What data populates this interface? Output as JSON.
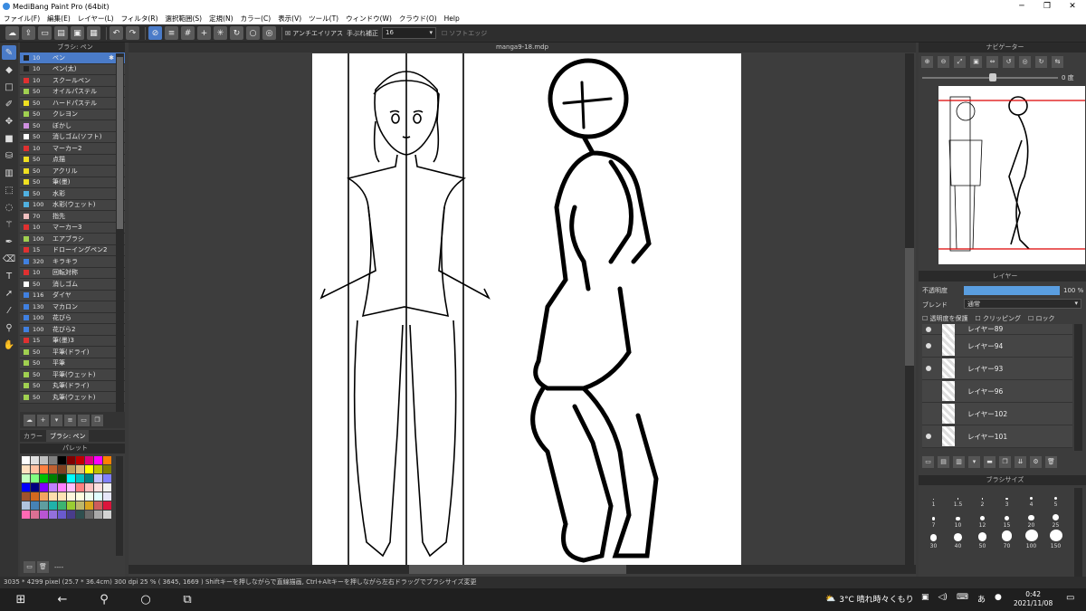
{
  "window": {
    "title": "MediBang Paint Pro (64bit)",
    "min": "─",
    "max": "❐",
    "close": "✕"
  },
  "menu": [
    "ファイル(F)",
    "編集(E)",
    "レイヤー(L)",
    "フィルタ(R)",
    "選択範囲(S)",
    "定規(N)",
    "カラー(C)",
    "表示(V)",
    "ツール(T)",
    "ウィンドウ(W)",
    "クラウド(O)",
    "Help"
  ],
  "toolbar": {
    "antialias": "アンチエイリアス",
    "stabilizer": "手ぶれ補正",
    "stabilizer_value": "16",
    "soft_edge": "ソフトエッジ"
  },
  "brush_panel": {
    "title": "ブラシ: ペン",
    "items": [
      {
        "size": "10",
        "name": "ペン",
        "color": "#222222",
        "selected": true
      },
      {
        "size": "10",
        "name": "ペン(太)",
        "color": "#222222"
      },
      {
        "size": "10",
        "name": "スクールペン",
        "color": "#e03030"
      },
      {
        "size": "50",
        "name": "オイルパステル",
        "color": "#a0d050"
      },
      {
        "size": "50",
        "name": "ハードパステル",
        "color": "#f0e020"
      },
      {
        "size": "50",
        "name": "クレヨン",
        "color": "#a0d050"
      },
      {
        "size": "50",
        "name": "ぼかし",
        "color": "#d090e0"
      },
      {
        "size": "50",
        "name": "消しゴム(ソフト)",
        "color": "#ffffff"
      },
      {
        "size": "10",
        "name": "マーカー2",
        "color": "#e03030"
      },
      {
        "size": "50",
        "name": "点描",
        "color": "#f0e020"
      },
      {
        "size": "50",
        "name": "アクリル",
        "color": "#f0e020"
      },
      {
        "size": "50",
        "name": "筆(墨)",
        "color": "#f0e020"
      },
      {
        "size": "50",
        "name": "水彩",
        "color": "#50b0e0"
      },
      {
        "size": "100",
        "name": "水彩(ウェット)",
        "color": "#50b0e0"
      },
      {
        "size": "70",
        "name": "指先",
        "color": "#f0c0c0"
      },
      {
        "size": "10",
        "name": "マーカー3",
        "color": "#e03030"
      },
      {
        "size": "100",
        "name": "エアブラシ",
        "color": "#a0d050"
      },
      {
        "size": "15",
        "name": "ドローイングペン2",
        "color": "#e03030"
      },
      {
        "size": "320",
        "name": "キラキラ",
        "color": "#4080e0"
      },
      {
        "size": "10",
        "name": "回転対称",
        "color": "#e03030"
      },
      {
        "size": "50",
        "name": "消しゴム",
        "color": "#ffffff"
      },
      {
        "size": "116",
        "name": "ダイヤ",
        "color": "#4080e0"
      },
      {
        "size": "130",
        "name": "マカロン",
        "color": "#4080e0"
      },
      {
        "size": "100",
        "name": "花びら",
        "color": "#4080e0"
      },
      {
        "size": "100",
        "name": "花びら2",
        "color": "#4080e0"
      },
      {
        "size": "15",
        "name": "筆(墨)3",
        "color": "#e03030"
      },
      {
        "size": "50",
        "name": "平筆(ドライ)",
        "color": "#a0d050"
      },
      {
        "size": "50",
        "name": "平筆",
        "color": "#a0d050"
      },
      {
        "size": "50",
        "name": "平筆(ウェット)",
        "color": "#a0d050"
      },
      {
        "size": "50",
        "name": "丸筆(ドライ)",
        "color": "#a0d050"
      },
      {
        "size": "50",
        "name": "丸筆(ウェット)",
        "color": "#a0d050"
      }
    ]
  },
  "tabs": [
    "カラー",
    "ブラシ: ペン"
  ],
  "palette": {
    "title": "パレット",
    "colors": [
      "#ffffff",
      "#e0e0e0",
      "#c0c0c0",
      "#808080",
      "#000000",
      "#800000",
      "#c00000",
      "#e00080",
      "#ff00ff",
      "#ff8000",
      "#ffe0c0",
      "#ffc0a0",
      "#ff8040",
      "#c06030",
      "#804020",
      "#c0a060",
      "#e0c080",
      "#ffff00",
      "#c0c000",
      "#808000",
      "#c0ffc0",
      "#80ff80",
      "#00c000",
      "#008000",
      "#004000",
      "#00ffff",
      "#00c0c0",
      "#008080",
      "#c0c0ff",
      "#8080ff",
      "#0000ff",
      "#000080",
      "#8000ff",
      "#c080ff",
      "#ff80ff",
      "#ffc0ff",
      "#ff8080",
      "#ffc0c0",
      "#ffe0e0",
      "#f0f0f0",
      "#a0522d",
      "#d2691e",
      "#f4a460",
      "#ffdead",
      "#ffe4b5",
      "#fff8dc",
      "#ffffe0",
      "#f0fff0",
      "#e0ffff",
      "#e6e6fa",
      "#b0c4de",
      "#4682b4",
      "#5f9ea0",
      "#20b2aa",
      "#3cb371",
      "#9acd32",
      "#bdb76b",
      "#daa520",
      "#cd5c5c",
      "#dc143c",
      "#ff69b4",
      "#db7093",
      "#ba55d3",
      "#9370db",
      "#6a5acd",
      "#483d8b",
      "#2f4f4f",
      "#696969",
      "#a9a9a9",
      "#d3d3d3"
    ],
    "footer": "----"
  },
  "document": {
    "tab": "manga9-18.mdp"
  },
  "navigator": {
    "title": "ナビゲーター",
    "zoom_label": "0 度"
  },
  "layer_panel": {
    "title": "レイヤー",
    "opacity_label": "不透明度",
    "opacity_value": "100 %",
    "opacity_pct": 100,
    "blend_label": "ブレンド",
    "blend_value": "通常",
    "protect": "透明度を保護",
    "clipping": "クリッピング",
    "lock": "ロック",
    "layers": [
      {
        "name": "レイヤー89",
        "visible": true
      },
      {
        "name": "レイヤー94",
        "visible": true
      },
      {
        "name": "レイヤー93",
        "visible": true
      },
      {
        "name": "レイヤー96",
        "visible": false
      },
      {
        "name": "レイヤー102",
        "visible": false
      },
      {
        "name": "レイヤー101",
        "visible": true
      }
    ]
  },
  "brush_size": {
    "title": "ブラシサイズ",
    "sizes": [
      "1",
      "1.5",
      "2",
      "3",
      "4",
      "5",
      "7",
      "10",
      "12",
      "15",
      "20",
      "25",
      "30",
      "40",
      "50",
      "70",
      "100",
      "150"
    ]
  },
  "status": "3035 * 4299 pixel  (25.7 * 36.4cm)  300 dpi  25 %  ( 3645, 1669 )  Shiftキーを押しながらで直線描画, Ctrl+Altキーを押しながら左右ドラッグでブラシサイズ変更",
  "taskbar": {
    "weather": "3°C  晴れ時々くもり",
    "time": "0:42",
    "date": "2021/11/08"
  }
}
